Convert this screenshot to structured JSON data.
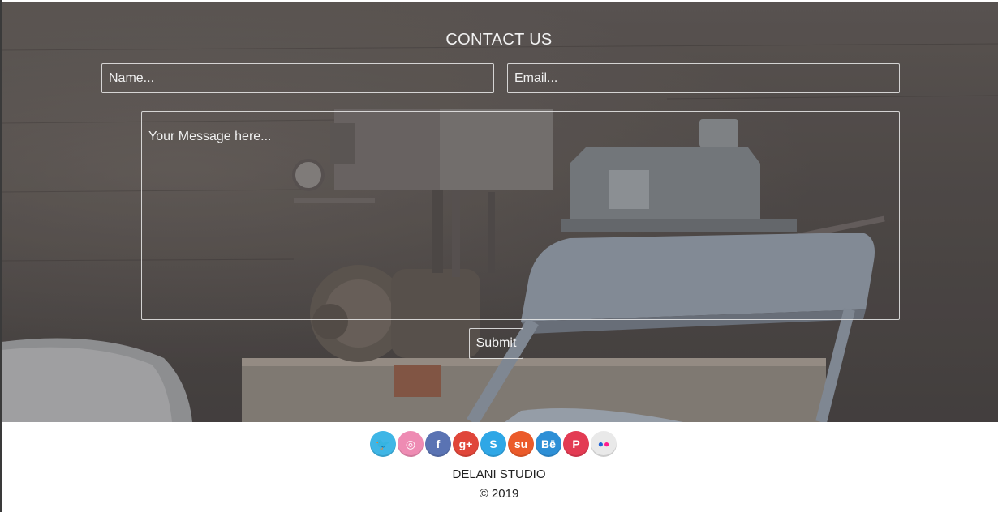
{
  "contact": {
    "title": "CONTACT US",
    "name_placeholder": "Name...",
    "email_placeholder": "Email...",
    "message_placeholder": "Your Message here...",
    "submit_label": "Submit"
  },
  "social": [
    {
      "name": "twitter-icon",
      "color": "#3fb6e6",
      "glyph": "🐦"
    },
    {
      "name": "dribbble-icon",
      "color": "#ee8bb3",
      "glyph": "◎"
    },
    {
      "name": "facebook-icon",
      "color": "#5a73b3",
      "glyph": "f"
    },
    {
      "name": "google-plus-icon",
      "color": "#e0463a",
      "glyph": "g+"
    },
    {
      "name": "skype-icon",
      "color": "#2fa7e6",
      "glyph": "S"
    },
    {
      "name": "stumbleupon-icon",
      "color": "#eb5a2a",
      "glyph": "su"
    },
    {
      "name": "behance-icon",
      "color": "#2d8fd6",
      "glyph": "Bē"
    },
    {
      "name": "pinterest-icon",
      "color": "#e33b53",
      "glyph": "P"
    },
    {
      "name": "flickr-icon",
      "color": "#e9e9e9",
      "glyph": "●●"
    }
  ],
  "footer": {
    "brand": "DELANI STUDIO",
    "copyright": "© 2019"
  }
}
